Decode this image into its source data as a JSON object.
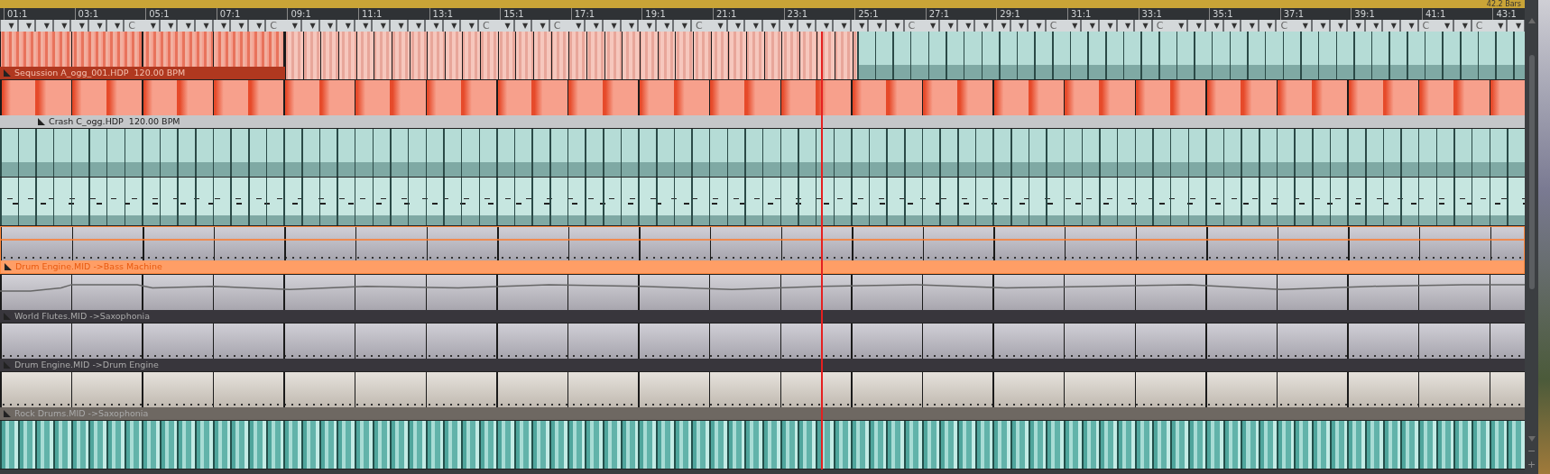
{
  "header": {
    "length": "42.2 Bars"
  },
  "ruler": [
    "01:1",
    "03:1",
    "05:1",
    "07:1",
    "09:1",
    "11:1",
    "13:1",
    "15:1",
    "17:1",
    "19:1",
    "21:1",
    "23:1",
    "25:1",
    "27:1",
    "29:1",
    "31:1",
    "33:1",
    "35:1",
    "37:1",
    "39:1",
    "41:1",
    "43:1"
  ],
  "markers": [
    {
      "arrow": "▼"
    },
    {
      "arrow": "▼"
    },
    {
      "arrow": "▼"
    },
    {
      "arrow": "▼"
    },
    {
      "arrow": "▼"
    },
    {
      "arrow": "▼"
    },
    {
      "arrow": "▼"
    },
    {
      "letter": "C",
      "arrow": "▼"
    },
    {
      "arrow": "▼"
    },
    {
      "arrow": "▼"
    },
    {
      "arrow": "▼"
    },
    {
      "arrow": "▼"
    },
    {
      "arrow": "▼"
    },
    {
      "arrow": "▼"
    },
    {
      "letter": "C",
      "arrow": "▼"
    },
    {
      "arrow": "▼"
    },
    {
      "arrow": "▼"
    },
    {
      "arrow": "▼"
    },
    {
      "arrow": "▼"
    },
    {
      "arrow": "▼"
    },
    {
      "arrow": "▼"
    },
    {
      "arrow": "▼"
    },
    {
      "arrow": "▼"
    },
    {
      "arrow": "▼"
    },
    {
      "arrow": "▼"
    },
    {
      "letter": "C",
      "arrow": "▼"
    },
    {
      "arrow": "▼"
    },
    {
      "arrow": "▼"
    },
    {
      "letter": "C",
      "arrow": "▼"
    },
    {
      "arrow": "▼"
    },
    {
      "arrow": "▼"
    },
    {
      "arrow": "▼"
    },
    {
      "arrow": "▼"
    },
    {
      "arrow": "▼"
    },
    {
      "arrow": "▼"
    },
    {
      "letter": "C",
      "arrow": "▼"
    },
    {
      "arrow": "▼"
    },
    {
      "arrow": "▼"
    },
    {
      "arrow": "▼"
    },
    {
      "arrow": "▼"
    },
    {
      "arrow": "▼"
    },
    {
      "arrow": "▼"
    },
    {
      "arrow": "▼"
    },
    {
      "arrow": "▼"
    },
    {
      "arrow": "▼"
    },
    {
      "arrow": "▼"
    },
    {
      "letter": "C",
      "arrow": "▼"
    },
    {
      "arrow": "▼"
    },
    {
      "arrow": "▼"
    },
    {
      "arrow": "▼"
    },
    {
      "arrow": "▼"
    },
    {
      "arrow": "▼"
    },
    {
      "arrow": "▼"
    },
    {
      "letter": "C",
      "arrow": "▼"
    },
    {
      "arrow": "▼"
    },
    {
      "arrow": "▼"
    },
    {
      "arrow": "▼"
    },
    {
      "arrow": "▼"
    },
    {
      "letter": "C",
      "arrow": "▼"
    },
    {
      "arrow": "▼"
    },
    {
      "arrow": "▼"
    },
    {
      "arrow": "▼"
    },
    {
      "arrow": "▼"
    },
    {
      "arrow": "▼"
    },
    {
      "letter": "C",
      "arrow": "▼"
    },
    {
      "arrow": "▼"
    },
    {
      "arrow": "▼"
    },
    {
      "arrow": "▼"
    },
    {
      "arrow": "▼"
    },
    {
      "arrow": "▼"
    },
    {
      "arrow": "▼"
    },
    {
      "letter": "C",
      "arrow": "▼"
    },
    {
      "arrow": "▼"
    },
    {
      "letter": "C",
      "arrow": "▼"
    },
    {
      "arrow": "▼"
    }
  ],
  "tracks": [
    {
      "selected": false,
      "clips": [
        {
          "kind": "loop",
          "label": "Sequssion A_ogg_001.HDP  120.00 BPM"
        },
        {
          "kind": "repeat"
        },
        {
          "kind": "wave"
        }
      ]
    },
    {
      "selected": false,
      "clips": [
        {
          "kind": "oneshot",
          "label": "Crash C_ogg.HDP  120.00 BPM"
        }
      ]
    },
    {
      "selected": false,
      "clips": [
        {
          "kind": "wave"
        }
      ]
    },
    {
      "selected": false,
      "clips": [
        {
          "kind": "notes"
        }
      ]
    },
    {
      "selected": true,
      "clips": [
        {
          "kind": "automation",
          "label": "Drum Engine.MID ->Bass Machine"
        }
      ]
    },
    {
      "selected": false,
      "clips": [
        {
          "kind": "curve",
          "label": "World Flutes.MID ->Saxophonia"
        }
      ]
    },
    {
      "selected": false,
      "clips": [
        {
          "kind": "plain",
          "label": "Drum Engine.MID ->Drum Engine"
        }
      ]
    },
    {
      "selected": false,
      "clips": [
        {
          "kind": "light",
          "label": "Rock Drums.MID ->Saxophonia"
        }
      ]
    },
    {
      "selected": false,
      "clips": [
        {
          "kind": "drums"
        }
      ]
    }
  ],
  "scrollbar": {
    "minus": "−",
    "plus": "+"
  }
}
